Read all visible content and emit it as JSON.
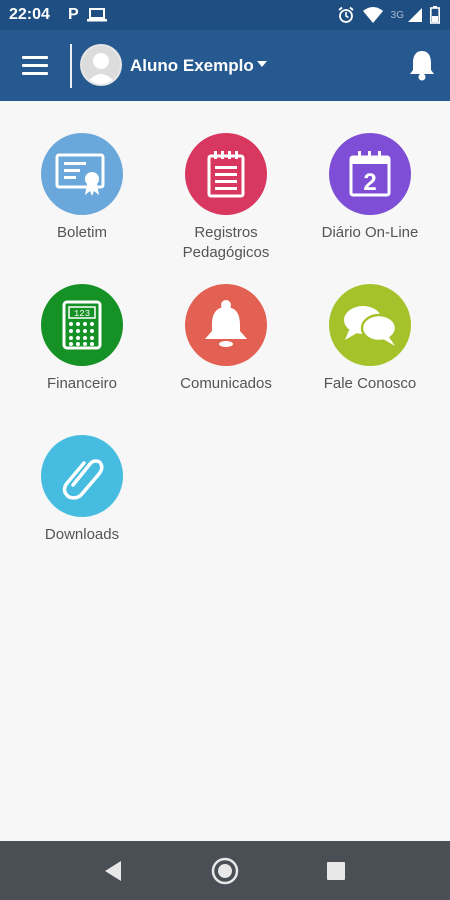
{
  "status": {
    "time": "22:04",
    "p_label": "P",
    "network": "3G"
  },
  "header": {
    "user_name": "Aluno Exemplo"
  },
  "tiles": [
    {
      "label": "Boletim",
      "color": "#6aa8dc"
    },
    {
      "label": "Registros\nPedagógicos",
      "color": "#d8375f"
    },
    {
      "label": "Diário On-Line",
      "color": "#7e4fd6",
      "calendar_number": "2"
    },
    {
      "label": "Financeiro",
      "color": "#169126",
      "calculator_text": "123"
    },
    {
      "label": "Comunicados",
      "color": "#e26152"
    },
    {
      "label": "Fale Conosco",
      "color": "#a5c22a"
    },
    {
      "label": "Downloads",
      "color": "#46bde0"
    }
  ],
  "colors": {
    "status_bar": "#1f4f82",
    "app_bar": "#25598f",
    "background": "#f7f7f7",
    "nav_bar": "#4a4f55"
  }
}
